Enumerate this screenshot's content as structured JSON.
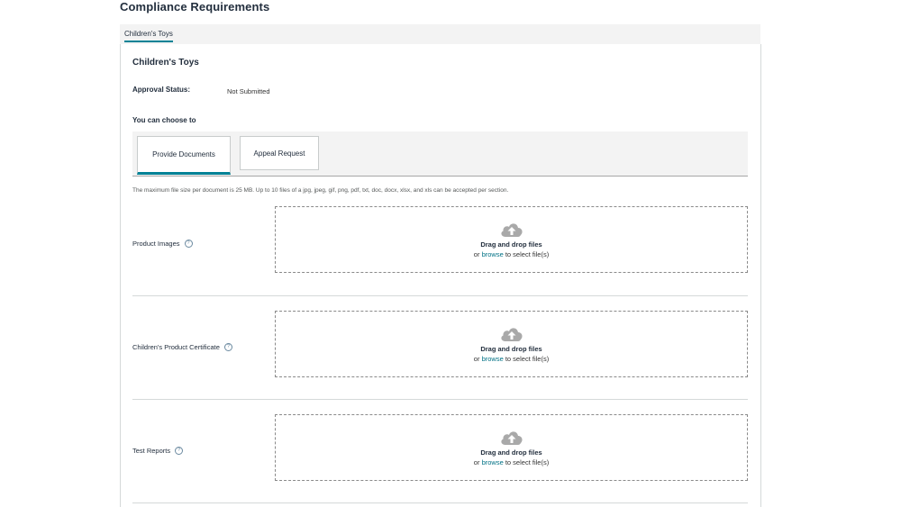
{
  "page": {
    "title": "Compliance Requirements"
  },
  "top_tabs": [
    {
      "label": "Children's Toys"
    }
  ],
  "section": {
    "title": "Children's Toys",
    "approval_status_label": "Approval Status:",
    "approval_status_value": "Not Submitted",
    "choose_label": "You can choose to"
  },
  "options": [
    {
      "label": "Provide Documents",
      "selected": true
    },
    {
      "label": "Appeal Request",
      "selected": false
    }
  ],
  "hint": "The maximum file size per document is 25 MB. Up to 10 files of a jpg, jpeg, gif, png, pdf, txt, doc, docx, xlsx, and xls can be accepted per section.",
  "uploads": [
    {
      "label": "Product Images",
      "drag_text": "Drag and drop files",
      "or_text": "or",
      "browse_text": "browse",
      "select_text": "to select file(s)"
    },
    {
      "label": "Children's Product Certificate",
      "drag_text": "Drag and drop files",
      "or_text": "or",
      "browse_text": "browse",
      "select_text": "to select file(s)"
    },
    {
      "label": "Test Reports",
      "drag_text": "Drag and drop files",
      "or_text": "or",
      "browse_text": "browse",
      "select_text": "to select file(s)"
    }
  ],
  "icons": {
    "help": "help-icon",
    "upload": "cloud-upload-icon"
  },
  "colors": {
    "accent": "#008296",
    "link": "#007185",
    "text": "#232f3e",
    "icon_gray": "#a9a9a9"
  }
}
